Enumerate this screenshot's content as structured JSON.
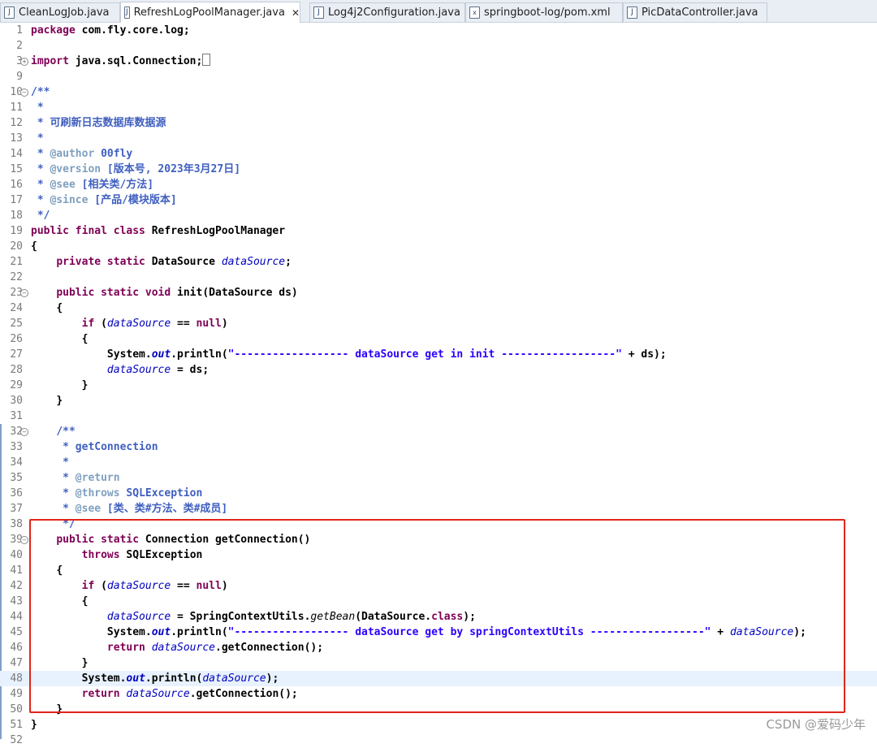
{
  "tabs": [
    {
      "label": "CleanLogJob.java",
      "icon": "java-file-icon",
      "active": false
    },
    {
      "label": "RefreshLogPoolManager.java",
      "icon": "java-file-icon",
      "active": true
    },
    {
      "label": "Log4j2Configuration.java",
      "icon": "java-file-icon",
      "active": false
    },
    {
      "label": "springboot-log/pom.xml",
      "icon": "xml-file-icon",
      "active": false
    },
    {
      "label": "PicDataController.java",
      "icon": "java-file-icon",
      "active": false
    }
  ],
  "editor": {
    "file": "RefreshLogPoolManager.java",
    "highlighted_line": 48,
    "line_numbers": [
      "1",
      "2",
      "3",
      "9",
      "10",
      "11",
      "12",
      "13",
      "14",
      "15",
      "16",
      "17",
      "18",
      "19",
      "20",
      "21",
      "22",
      "23",
      "24",
      "25",
      "26",
      "27",
      "28",
      "29",
      "30",
      "31",
      "32",
      "33",
      "34",
      "35",
      "36",
      "37",
      "38",
      "39",
      "40",
      "41",
      "42",
      "43",
      "44",
      "45",
      "46",
      "47",
      "48",
      "49",
      "50",
      "51",
      "52"
    ],
    "lines": [
      "package com.fly.core.log;",
      "",
      "import java.sql.Connection;",
      "",
      "/**",
      " *",
      " * 可刷新日志数据库数据源",
      " *",
      " * @author 00fly",
      " * @version [版本号, 2023年3月27日]",
      " * @see [相关类/方法]",
      " * @since [产品/模块版本]",
      " */",
      "public final class RefreshLogPoolManager",
      "{",
      "    private static DataSource dataSource;",
      "",
      "    public static void init(DataSource ds)",
      "    {",
      "        if (dataSource == null)",
      "        {",
      "            System.out.println(\"------------------ dataSource get in init ------------------\" + ds);",
      "            dataSource = ds;",
      "        }",
      "    }",
      "",
      "    /**",
      "     * getConnection",
      "     *",
      "     * @return",
      "     * @throws SQLException",
      "     * @see [类、类#方法、类#成员]",
      "     */",
      "    public static Connection getConnection()",
      "        throws SQLException",
      "    {",
      "        if (dataSource == null)",
      "        {",
      "            dataSource = SpringContextUtils.getBean(DataSource.class);",
      "            System.out.println(\"------------------ dataSource get by springContextUtils ------------------\" + dataSource);",
      "            return dataSource.getConnection();",
      "        }",
      "        System.out.println(dataSource);",
      "        return dataSource.getConnection();",
      "    }",
      "}",
      ""
    ]
  },
  "watermark": "CSDN @爱码少年",
  "colors": {
    "keyword": "#7f0055",
    "comment": "#3f5fbf",
    "javadoc_tag": "#7f9fbf",
    "string": "#2a00ff",
    "field": "#0000c0",
    "highlight_box": "#e0251c",
    "current_line": "#e8f2fe"
  }
}
